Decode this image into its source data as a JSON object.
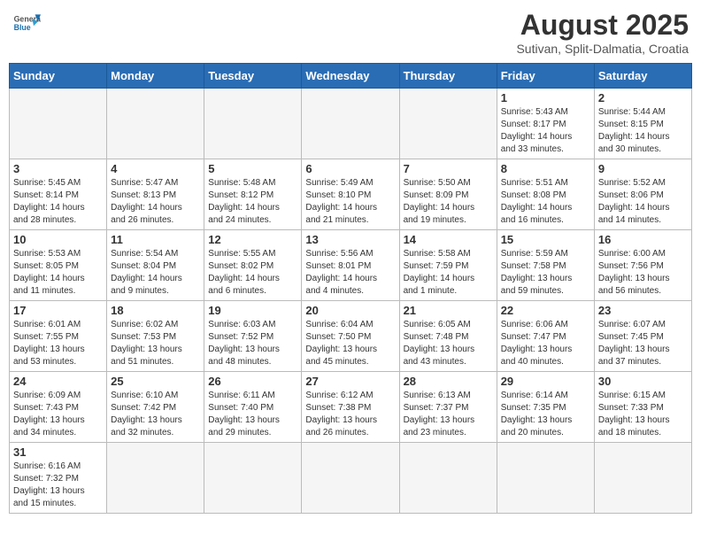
{
  "header": {
    "logo_general": "General",
    "logo_blue": "Blue",
    "month_title": "August 2025",
    "subtitle": "Sutivan, Split-Dalmatia, Croatia"
  },
  "weekdays": [
    "Sunday",
    "Monday",
    "Tuesday",
    "Wednesday",
    "Thursday",
    "Friday",
    "Saturday"
  ],
  "weeks": [
    [
      {
        "day": "",
        "info": ""
      },
      {
        "day": "",
        "info": ""
      },
      {
        "day": "",
        "info": ""
      },
      {
        "day": "",
        "info": ""
      },
      {
        "day": "",
        "info": ""
      },
      {
        "day": "1",
        "info": "Sunrise: 5:43 AM\nSunset: 8:17 PM\nDaylight: 14 hours\nand 33 minutes."
      },
      {
        "day": "2",
        "info": "Sunrise: 5:44 AM\nSunset: 8:15 PM\nDaylight: 14 hours\nand 30 minutes."
      }
    ],
    [
      {
        "day": "3",
        "info": "Sunrise: 5:45 AM\nSunset: 8:14 PM\nDaylight: 14 hours\nand 28 minutes."
      },
      {
        "day": "4",
        "info": "Sunrise: 5:47 AM\nSunset: 8:13 PM\nDaylight: 14 hours\nand 26 minutes."
      },
      {
        "day": "5",
        "info": "Sunrise: 5:48 AM\nSunset: 8:12 PM\nDaylight: 14 hours\nand 24 minutes."
      },
      {
        "day": "6",
        "info": "Sunrise: 5:49 AM\nSunset: 8:10 PM\nDaylight: 14 hours\nand 21 minutes."
      },
      {
        "day": "7",
        "info": "Sunrise: 5:50 AM\nSunset: 8:09 PM\nDaylight: 14 hours\nand 19 minutes."
      },
      {
        "day": "8",
        "info": "Sunrise: 5:51 AM\nSunset: 8:08 PM\nDaylight: 14 hours\nand 16 minutes."
      },
      {
        "day": "9",
        "info": "Sunrise: 5:52 AM\nSunset: 8:06 PM\nDaylight: 14 hours\nand 14 minutes."
      }
    ],
    [
      {
        "day": "10",
        "info": "Sunrise: 5:53 AM\nSunset: 8:05 PM\nDaylight: 14 hours\nand 11 minutes."
      },
      {
        "day": "11",
        "info": "Sunrise: 5:54 AM\nSunset: 8:04 PM\nDaylight: 14 hours\nand 9 minutes."
      },
      {
        "day": "12",
        "info": "Sunrise: 5:55 AM\nSunset: 8:02 PM\nDaylight: 14 hours\nand 6 minutes."
      },
      {
        "day": "13",
        "info": "Sunrise: 5:56 AM\nSunset: 8:01 PM\nDaylight: 14 hours\nand 4 minutes."
      },
      {
        "day": "14",
        "info": "Sunrise: 5:58 AM\nSunset: 7:59 PM\nDaylight: 14 hours\nand 1 minute."
      },
      {
        "day": "15",
        "info": "Sunrise: 5:59 AM\nSunset: 7:58 PM\nDaylight: 13 hours\nand 59 minutes."
      },
      {
        "day": "16",
        "info": "Sunrise: 6:00 AM\nSunset: 7:56 PM\nDaylight: 13 hours\nand 56 minutes."
      }
    ],
    [
      {
        "day": "17",
        "info": "Sunrise: 6:01 AM\nSunset: 7:55 PM\nDaylight: 13 hours\nand 53 minutes."
      },
      {
        "day": "18",
        "info": "Sunrise: 6:02 AM\nSunset: 7:53 PM\nDaylight: 13 hours\nand 51 minutes."
      },
      {
        "day": "19",
        "info": "Sunrise: 6:03 AM\nSunset: 7:52 PM\nDaylight: 13 hours\nand 48 minutes."
      },
      {
        "day": "20",
        "info": "Sunrise: 6:04 AM\nSunset: 7:50 PM\nDaylight: 13 hours\nand 45 minutes."
      },
      {
        "day": "21",
        "info": "Sunrise: 6:05 AM\nSunset: 7:48 PM\nDaylight: 13 hours\nand 43 minutes."
      },
      {
        "day": "22",
        "info": "Sunrise: 6:06 AM\nSunset: 7:47 PM\nDaylight: 13 hours\nand 40 minutes."
      },
      {
        "day": "23",
        "info": "Sunrise: 6:07 AM\nSunset: 7:45 PM\nDaylight: 13 hours\nand 37 minutes."
      }
    ],
    [
      {
        "day": "24",
        "info": "Sunrise: 6:09 AM\nSunset: 7:43 PM\nDaylight: 13 hours\nand 34 minutes."
      },
      {
        "day": "25",
        "info": "Sunrise: 6:10 AM\nSunset: 7:42 PM\nDaylight: 13 hours\nand 32 minutes."
      },
      {
        "day": "26",
        "info": "Sunrise: 6:11 AM\nSunset: 7:40 PM\nDaylight: 13 hours\nand 29 minutes."
      },
      {
        "day": "27",
        "info": "Sunrise: 6:12 AM\nSunset: 7:38 PM\nDaylight: 13 hours\nand 26 minutes."
      },
      {
        "day": "28",
        "info": "Sunrise: 6:13 AM\nSunset: 7:37 PM\nDaylight: 13 hours\nand 23 minutes."
      },
      {
        "day": "29",
        "info": "Sunrise: 6:14 AM\nSunset: 7:35 PM\nDaylight: 13 hours\nand 20 minutes."
      },
      {
        "day": "30",
        "info": "Sunrise: 6:15 AM\nSunset: 7:33 PM\nDaylight: 13 hours\nand 18 minutes."
      }
    ],
    [
      {
        "day": "31",
        "info": "Sunrise: 6:16 AM\nSunset: 7:32 PM\nDaylight: 13 hours\nand 15 minutes."
      },
      {
        "day": "",
        "info": ""
      },
      {
        "day": "",
        "info": ""
      },
      {
        "day": "",
        "info": ""
      },
      {
        "day": "",
        "info": ""
      },
      {
        "day": "",
        "info": ""
      },
      {
        "day": "",
        "info": ""
      }
    ]
  ]
}
